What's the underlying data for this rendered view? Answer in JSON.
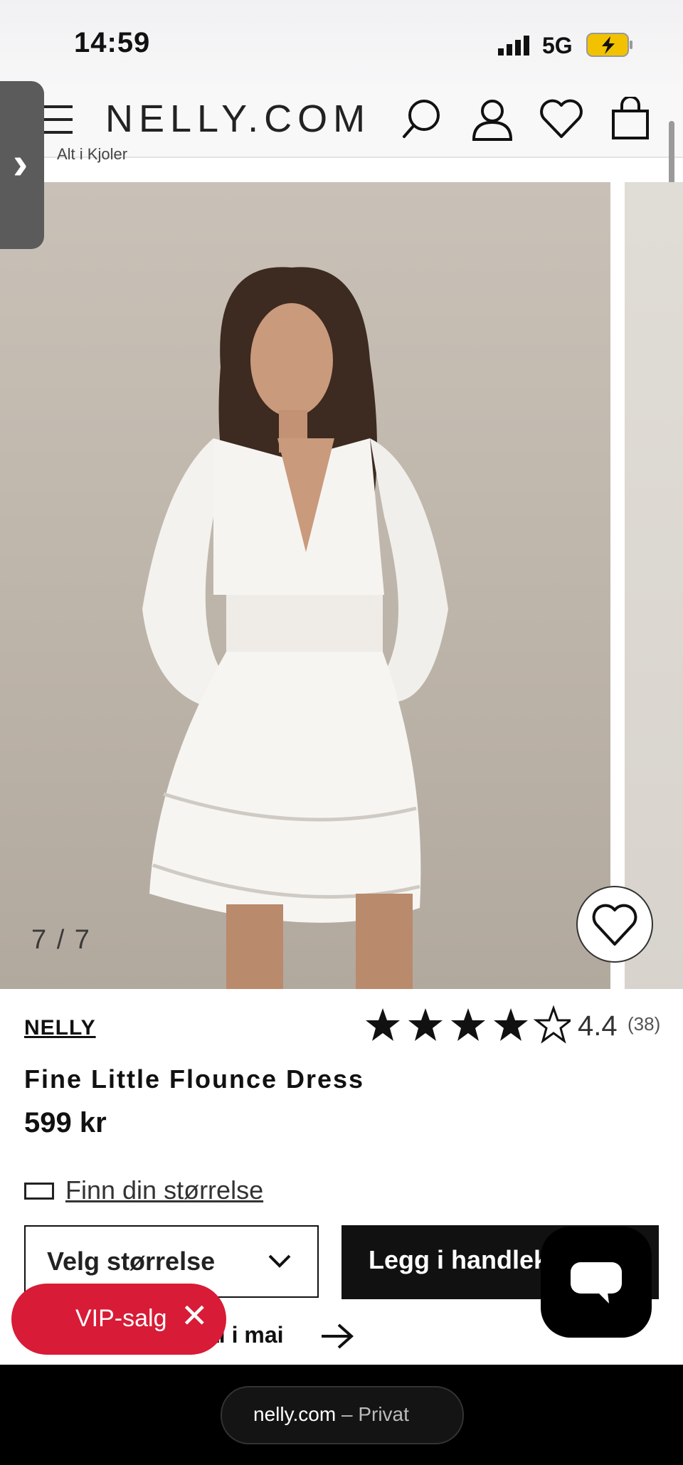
{
  "status_bar": {
    "time": "14:59",
    "network": "5G"
  },
  "header": {
    "logo": "NELLY.COM",
    "breadcrumb": "Alt i Kjoler"
  },
  "gallery": {
    "counter": "7 / 7"
  },
  "product": {
    "brand": "NELLY",
    "name": "Fine Little Flounce Dress",
    "price": "599 kr",
    "rating_value": "4.4",
    "rating_count": "(38)",
    "stars": 4.4
  },
  "actions": {
    "size_guide": "Finn din størrelse",
    "size_select": "Velg størrelse",
    "add_to_cart": "Legg i handlekurv",
    "promo": "al i mai"
  },
  "vip": {
    "label": "VIP-salg"
  },
  "browser": {
    "host": "nelly.com",
    "mode": "– Privat"
  },
  "colors": {
    "vip": "#d81b36",
    "button": "#111111"
  }
}
